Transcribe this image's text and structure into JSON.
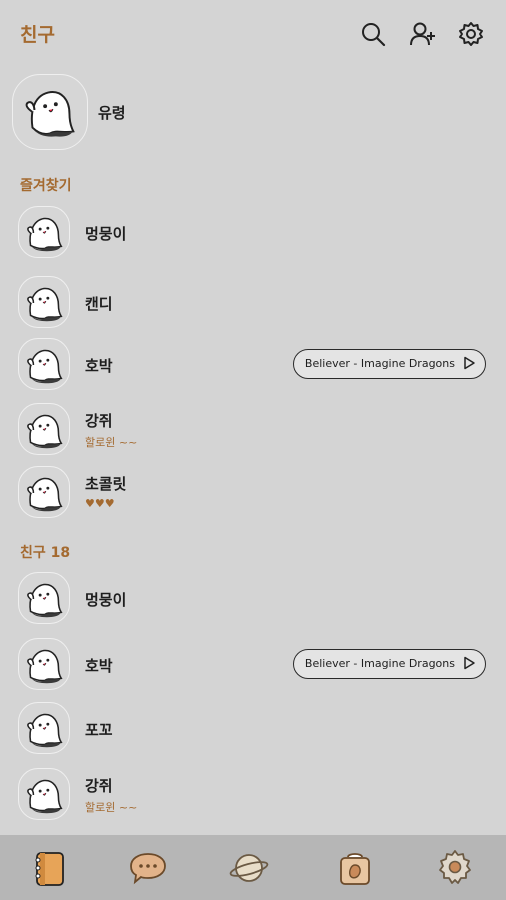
{
  "header": {
    "title": "친구",
    "icons": [
      "search-icon",
      "add-friend-icon",
      "settings-icon"
    ]
  },
  "me": {
    "name": "유령"
  },
  "favorites": {
    "label": "즐겨찾기",
    "items": [
      {
        "name": "멍뭉이"
      },
      {
        "name": "캔디"
      },
      {
        "name": "호박",
        "music": "Believer - Imagine Dragons"
      },
      {
        "name": "강쥐",
        "status": "할로윈 ~~"
      },
      {
        "name": "초콜릿",
        "status": "♥♥♥"
      }
    ]
  },
  "friends": {
    "label": "친구 18",
    "items": [
      {
        "name": "멍뭉이"
      },
      {
        "name": "호박",
        "music": "Believer - Imagine Dragons"
      },
      {
        "name": "포꼬"
      },
      {
        "name": "강쥐",
        "status": "할로윈 ~~"
      }
    ]
  },
  "tabbar": {
    "items": [
      "friends-tab",
      "chats-tab",
      "openchat-tab",
      "shopping-tab",
      "more-tab"
    ]
  },
  "colors": {
    "accent": "#a46a30",
    "background": "#d4d4d4",
    "tabbar": "#b6b6b6"
  }
}
